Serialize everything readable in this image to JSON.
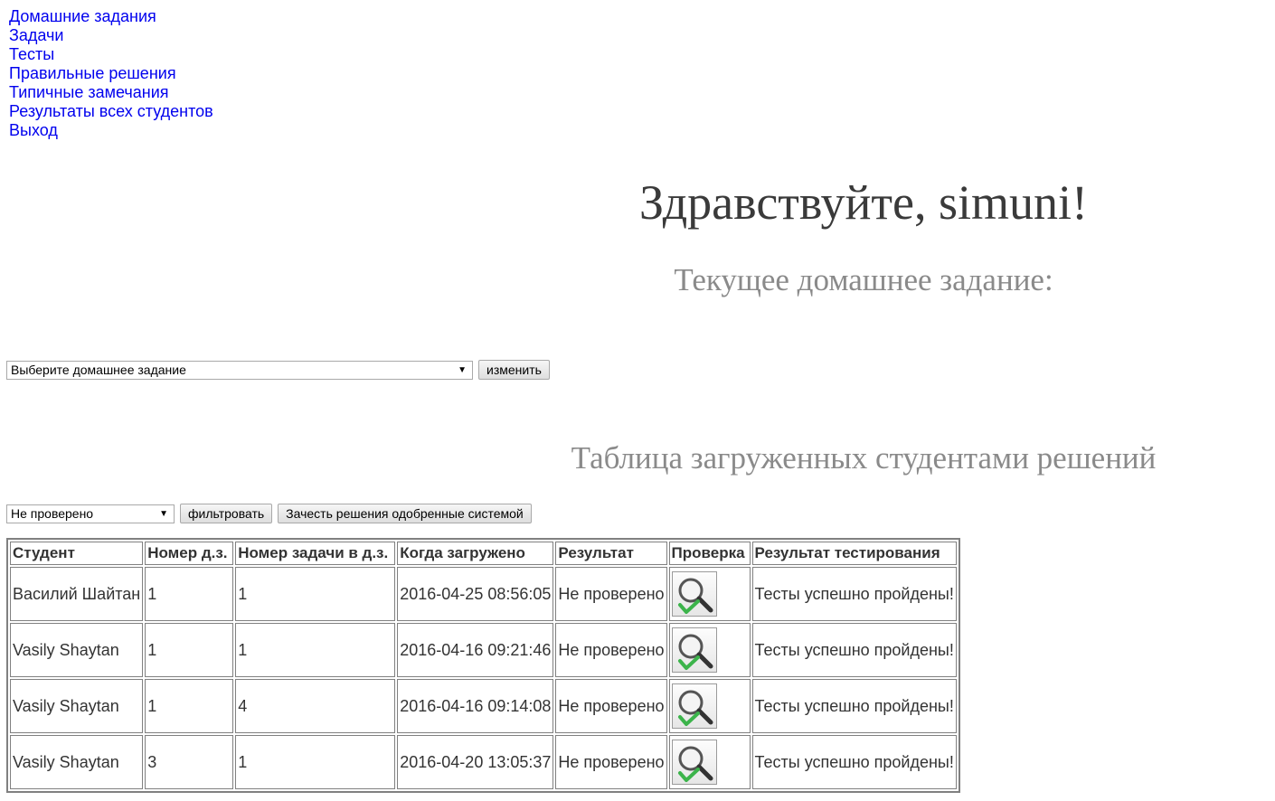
{
  "nav": {
    "items": [
      {
        "label": "Домашние задания"
      },
      {
        "label": "Задачи"
      },
      {
        "label": "Тесты"
      },
      {
        "label": "Правильные решения"
      },
      {
        "label": "Типичные замечания"
      },
      {
        "label": "Результаты всех студентов"
      },
      {
        "label": "Выход"
      }
    ]
  },
  "greeting": "Здравствуйте, simuni!",
  "current_homework_heading": "Текущее домашнее задание:",
  "homework_form": {
    "select_value": "Выберите домашнее задание",
    "change_label": "изменить"
  },
  "table_heading": "Таблица загруженных студентами решений",
  "filter_form": {
    "select_value": "Не проверено",
    "filter_label": "фильтровать",
    "approve_label": "Зачесть решения одобренные системой"
  },
  "table": {
    "columns": [
      "Студент",
      "Номер д.з.",
      "Номер задачи в д.з.",
      "Когда загружено",
      "Результат",
      "Проверка",
      "Результат тестирования"
    ],
    "rows": [
      {
        "student": "Василий Шайтан",
        "hw": "1",
        "task": "1",
        "uploaded": "2016-04-25 08:56:05",
        "result": "Не проверено",
        "check_icon": "magnifier-check-icon",
        "tests": "Тесты успешно пройдены!"
      },
      {
        "student": "Vasily Shaytan",
        "hw": "1",
        "task": "1",
        "uploaded": "2016-04-16 09:21:46",
        "result": "Не проверено",
        "check_icon": "magnifier-check-icon",
        "tests": "Тесты успешно пройдены!"
      },
      {
        "student": "Vasily Shaytan",
        "hw": "1",
        "task": "4",
        "uploaded": "2016-04-16 09:14:08",
        "result": "Не проверено",
        "check_icon": "magnifier-check-icon",
        "tests": "Тесты успешно пройдены!"
      },
      {
        "student": "Vasily Shaytan",
        "hw": "3",
        "task": "1",
        "uploaded": "2016-04-20 13:05:37",
        "result": "Не проверено",
        "check_icon": "magnifier-check-icon",
        "tests": "Тесты успешно пройдены!"
      }
    ]
  },
  "colors": {
    "link": "#0000ee",
    "heading_dark": "#3a3a3a",
    "heading_gray": "#8a8a8a",
    "check_green": "#3cb44b"
  }
}
